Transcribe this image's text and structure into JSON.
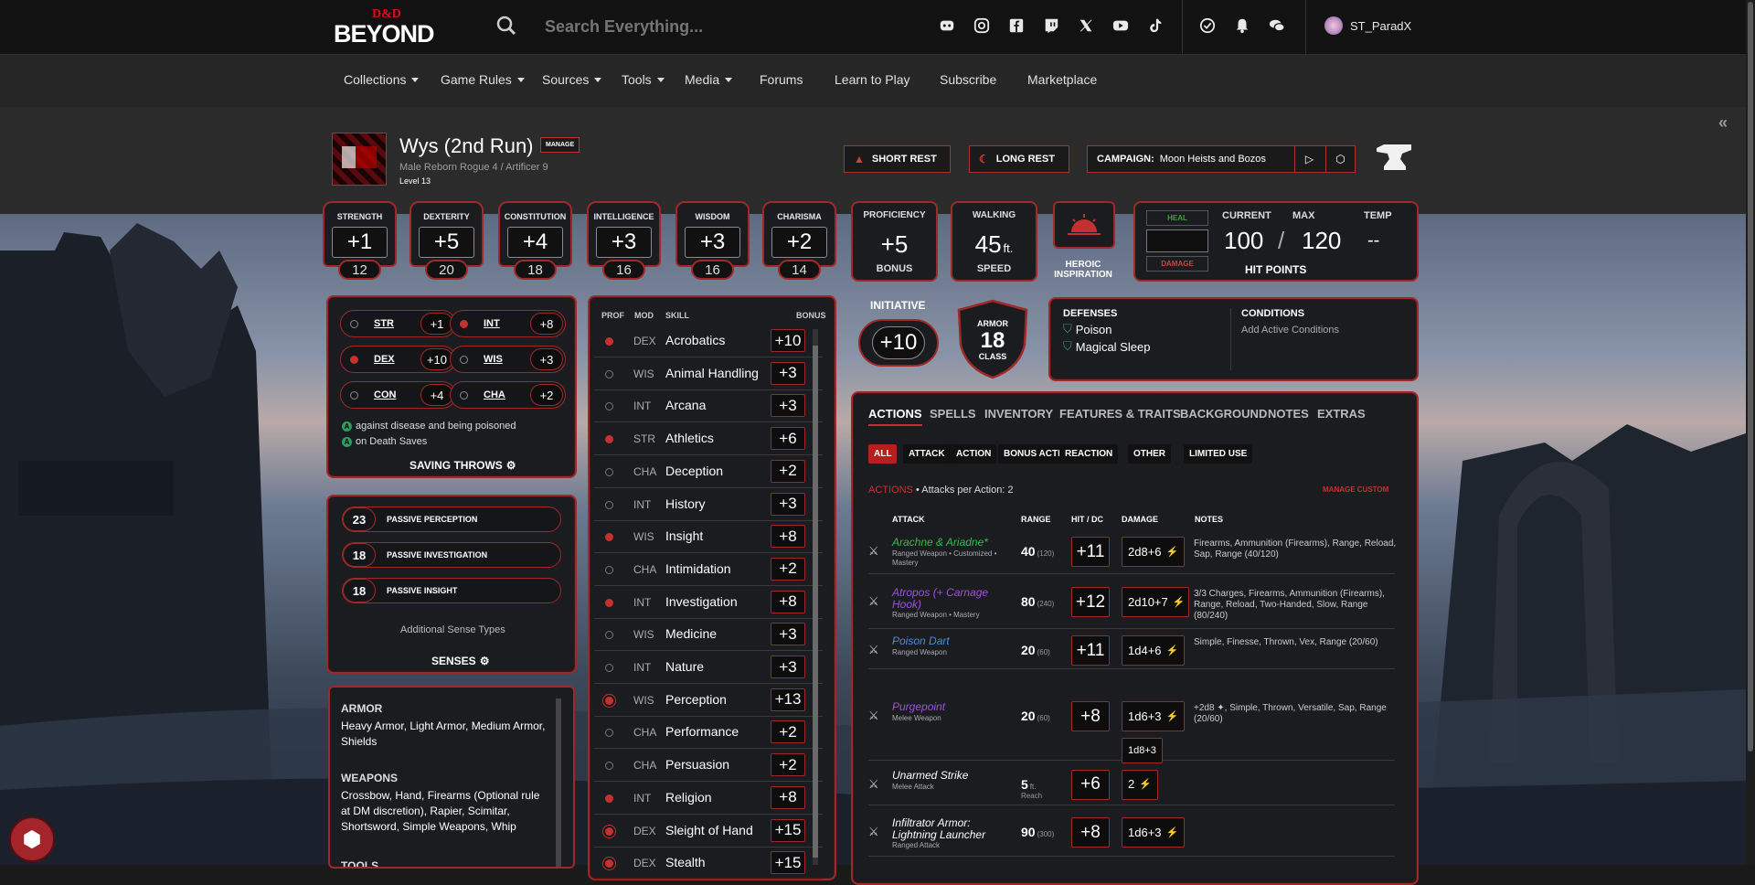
{
  "topbar": {
    "logo_top": "D&D",
    "logo_bottom": "BEYOND",
    "search_placeholder": "Search Everything...",
    "social_icons": [
      "discord-icon",
      "instagram-icon",
      "facebook-icon",
      "twitch-icon",
      "x-icon",
      "youtube-icon",
      "tiktok-icon"
    ],
    "username": "ST_ParadX"
  },
  "nav": {
    "items": [
      {
        "label": "Collections",
        "dropdown": true
      },
      {
        "label": "Game Rules",
        "dropdown": true
      },
      {
        "label": "Sources",
        "dropdown": true
      },
      {
        "label": "Tools",
        "dropdown": true
      },
      {
        "label": "Media",
        "dropdown": true
      },
      {
        "label": "Forums",
        "dropdown": false
      },
      {
        "label": "Learn to Play",
        "dropdown": false
      },
      {
        "label": "Subscribe",
        "dropdown": false
      },
      {
        "label": "Marketplace",
        "dropdown": false
      }
    ]
  },
  "character": {
    "name": "Wys (2nd Run)",
    "manage": "MANAGE",
    "sub": "Male  Reborn  Rogue 4 / Artificer 9",
    "level": "Level 13",
    "short_rest": "SHORT REST",
    "long_rest": "LONG REST",
    "campaign_label": "CAMPAIGN:",
    "campaign_name": "Moon Heists and Bozos"
  },
  "abilities": [
    {
      "name": "STRENGTH",
      "mod": "+1",
      "score": "12"
    },
    {
      "name": "DEXTERITY",
      "mod": "+5",
      "score": "20"
    },
    {
      "name": "CONSTITUTION",
      "mod": "+4",
      "score": "18"
    },
    {
      "name": "INTELLIGENCE",
      "mod": "+3",
      "score": "16"
    },
    {
      "name": "WISDOM",
      "mod": "+3",
      "score": "16"
    },
    {
      "name": "CHARISMA",
      "mod": "+2",
      "score": "14"
    }
  ],
  "proficiency": {
    "label": "PROFICIENCY",
    "value": "+5",
    "sub": "BONUS"
  },
  "speed": {
    "label": "WALKING",
    "value": "45",
    "unit": "ft.",
    "sub": "SPEED"
  },
  "inspiration": {
    "label_1": "HEROIC",
    "label_2": "INSPIRATION"
  },
  "hp": {
    "heal": "HEAL",
    "damage": "DAMAGE",
    "current_label": "CURRENT",
    "max_label": "MAX",
    "temp_label": "TEMP",
    "current": "100",
    "slash": "/",
    "max": "120",
    "temp": "--",
    "title": "HIT POINTS"
  },
  "saves": [
    {
      "ab": "STR",
      "bonus": "+1",
      "prof": false
    },
    {
      "ab": "INT",
      "bonus": "+8",
      "prof": true
    },
    {
      "ab": "DEX",
      "bonus": "+10",
      "prof": true
    },
    {
      "ab": "WIS",
      "bonus": "+3",
      "prof": false
    },
    {
      "ab": "CON",
      "bonus": "+4",
      "prof": false
    },
    {
      "ab": "CHA",
      "bonus": "+2",
      "prof": false
    }
  ],
  "save_notes": [
    "against disease and being poisoned",
    "on Death Saves"
  ],
  "saving_throws_title": "SAVING THROWS",
  "passives": [
    {
      "value": "23",
      "label": "PASSIVE PERCEPTION"
    },
    {
      "value": "18",
      "label": "PASSIVE INVESTIGATION"
    },
    {
      "value": "18",
      "label": "PASSIVE INSIGHT"
    }
  ],
  "additional_senses": "Additional Sense Types",
  "senses_title": "SENSES",
  "proficiencies": {
    "armor_h": "ARMOR",
    "armor": "Heavy Armor, Light Armor, Medium Armor, Shields",
    "weapons_h": "WEAPONS",
    "weapons": "Crossbow, Hand, Firearms (Optional rule at DM discretion), Rapier, Scimitar, Shortsword, Simple Weapons, Whip",
    "tools_h": "TOOLS"
  },
  "skills_header": {
    "prof": "PROF",
    "mod": "MOD",
    "skill": "SKILL",
    "bonus": "BONUS"
  },
  "skills": [
    {
      "mod": "DEX",
      "name": "Acrobatics",
      "bonus": "+10",
      "prof": "on"
    },
    {
      "mod": "WIS",
      "name": "Animal Handling",
      "bonus": "+3",
      "prof": "off"
    },
    {
      "mod": "INT",
      "name": "Arcana",
      "bonus": "+3",
      "prof": "off"
    },
    {
      "mod": "STR",
      "name": "Athletics",
      "bonus": "+6",
      "prof": "on"
    },
    {
      "mod": "CHA",
      "name": "Deception",
      "bonus": "+2",
      "prof": "off"
    },
    {
      "mod": "INT",
      "name": "History",
      "bonus": "+3",
      "prof": "off"
    },
    {
      "mod": "WIS",
      "name": "Insight",
      "bonus": "+8",
      "prof": "on"
    },
    {
      "mod": "CHA",
      "name": "Intimidation",
      "bonus": "+2",
      "prof": "off"
    },
    {
      "mod": "INT",
      "name": "Investigation",
      "bonus": "+8",
      "prof": "on"
    },
    {
      "mod": "WIS",
      "name": "Medicine",
      "bonus": "+3",
      "prof": "off"
    },
    {
      "mod": "INT",
      "name": "Nature",
      "bonus": "+3",
      "prof": "off"
    },
    {
      "mod": "WIS",
      "name": "Perception",
      "bonus": "+13",
      "prof": "exp"
    },
    {
      "mod": "CHA",
      "name": "Performance",
      "bonus": "+2",
      "prof": "off"
    },
    {
      "mod": "CHA",
      "name": "Persuasion",
      "bonus": "+2",
      "prof": "off"
    },
    {
      "mod": "INT",
      "name": "Religion",
      "bonus": "+8",
      "prof": "on"
    },
    {
      "mod": "DEX",
      "name": "Sleight of Hand",
      "bonus": "+15",
      "prof": "exp"
    },
    {
      "mod": "DEX",
      "name": "Stealth",
      "bonus": "+15",
      "prof": "exp"
    }
  ],
  "initiative": {
    "label": "INITIATIVE",
    "value": "+10"
  },
  "armor_class": {
    "top": "ARMOR",
    "value": "18",
    "bottom": "CLASS"
  },
  "defenses": {
    "title": "DEFENSES",
    "items": [
      "Poison",
      "Magical Sleep"
    ]
  },
  "conditions": {
    "title": "CONDITIONS",
    "add": "Add Active Conditions"
  },
  "tabs": [
    "ACTIONS",
    "SPELLS",
    "INVENTORY",
    "FEATURES & TRAITS",
    "BACKGROUND",
    "NOTES",
    "EXTRAS"
  ],
  "filters": [
    "ALL",
    "ATTACK",
    "ACTION",
    "BONUS ACTION",
    "REACTION",
    "OTHER",
    "LIMITED USE"
  ],
  "actions_label": "ACTIONS",
  "attacks_per_action": "• Attacks per Action: 2",
  "manage_custom": "MANAGE CUSTOM",
  "attack_header": {
    "attack": "ATTACK",
    "range": "RANGE",
    "hit": "HIT / DC",
    "damage": "DAMAGE",
    "notes": "NOTES"
  },
  "attacks": [
    {
      "name": "Arachne & Ariadne*",
      "color": "#2fbf4a",
      "sub": "Ranged Weapon • Customized • Mastery",
      "range": "40",
      "long": "(120)",
      "hit": "+11",
      "damage": "2d8+6",
      "notes": "Firearms, Ammunition (Firearms), Range, Reload, Sap, Range (40/120)"
    },
    {
      "name": "Atropos (+ Carnage Hook)",
      "color": "#a050e0",
      "sub": "Ranged Weapon • Mastery",
      "range": "80",
      "long": "(240)",
      "hit": "+12",
      "damage": "2d10+7",
      "notes": "3/3 Charges, Firearms, Ammunition (Firearms), Range, Reload, Two-Handed, Slow, Range (80/240)"
    },
    {
      "name": "Poison Dart",
      "color": "#4a8ce0",
      "sub": "Ranged Weapon",
      "range": "20",
      "long": "(60)",
      "hit": "+11",
      "damage": "1d4+6",
      "notes": "Simple, Finesse, Thrown, Vex, Range (20/60)"
    },
    {
      "name": "Purgepoint",
      "color": "#a050e0",
      "sub": "Melee Weapon",
      "range": "20",
      "long": "(60)",
      "hit": "+8",
      "damage": "1d6+3",
      "damage2": "1d8+3",
      "notes": "+2d8 ✦, Simple, Thrown, Versatile, Sap, Range (20/60)"
    },
    {
      "name": "Unarmed Strike",
      "color": "#ffffff",
      "sub": "Melee Attack",
      "range": "5",
      "long": "ft.",
      "extra": "Reach",
      "hit": "+6",
      "damage": "2",
      "notes": ""
    },
    {
      "name": "Infiltrator Armor: Lightning Launcher",
      "color": "#ffffff",
      "sub": "Ranged Attack",
      "range": "90",
      "long": "(300)",
      "hit": "+8",
      "damage": "1d6+3",
      "notes": ""
    }
  ],
  "colors": {
    "accent": "#c53131",
    "panel": "#1b1c20",
    "header": "#2b2b2b"
  }
}
